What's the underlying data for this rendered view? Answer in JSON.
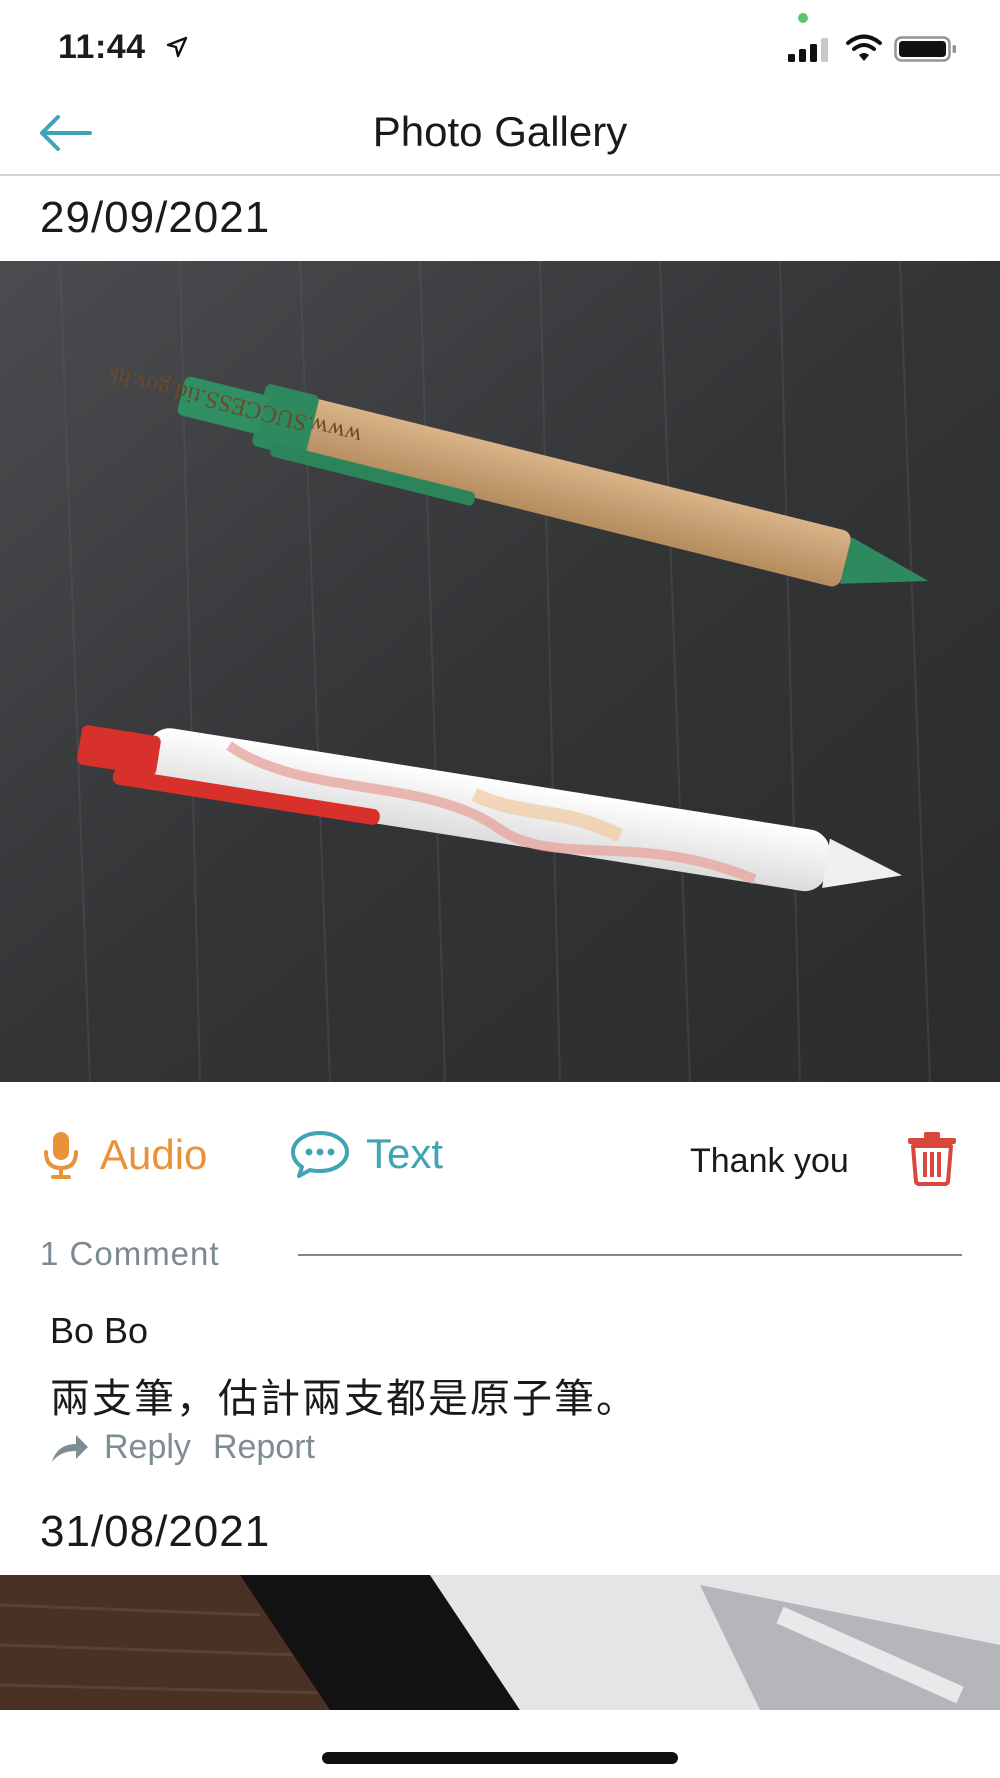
{
  "status_bar": {
    "time": "11:44"
  },
  "nav": {
    "title": "Photo Gallery"
  },
  "entries": [
    {
      "date": "29/09/2021",
      "pen_imprint": "www.SUCCESS.tid.gov.hk",
      "actions": {
        "audio_label": "Audio",
        "text_label": "Text",
        "caption": "Thank you"
      },
      "comments": {
        "count_label": "1  Comment",
        "items": [
          {
            "author": "Bo Bo",
            "body": "兩支筆，估計兩支都是原子筆。",
            "reply_label": "Reply",
            "report_label": "Report"
          }
        ]
      }
    },
    {
      "date": "31/08/2021"
    }
  ],
  "colors": {
    "accent_teal": "#3fa4b6",
    "accent_orange": "#e8923a",
    "delete_red": "#d9463c",
    "muted_gray": "#7a8a90"
  },
  "icons": [
    "location-arrow-icon",
    "signal-icon",
    "wifi-icon",
    "battery-icon",
    "back-arrow-icon",
    "microphone-icon",
    "chat-bubble-icon",
    "trash-icon",
    "reply-arrow-icon"
  ]
}
